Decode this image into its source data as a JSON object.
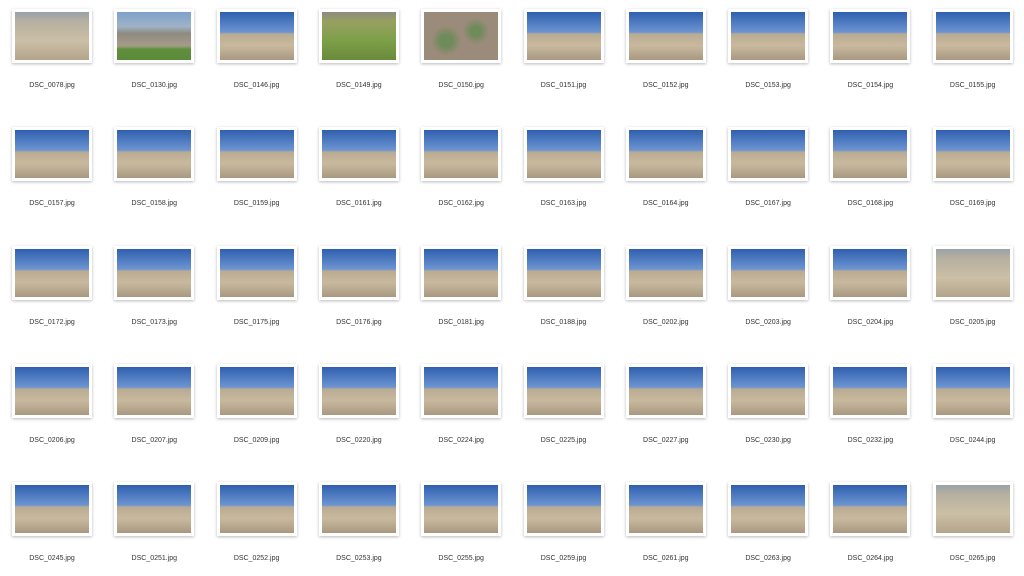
{
  "files": [
    {
      "name": "DSC_0078.jpg",
      "style": "dry"
    },
    {
      "name": "DSC_0130.jpg",
      "style": "mixed"
    },
    {
      "name": "DSC_0146.jpg",
      "style": "sky"
    },
    {
      "name": "DSC_0149.jpg",
      "style": "green"
    },
    {
      "name": "DSC_0150.jpg",
      "style": "plants"
    },
    {
      "name": "DSC_0151.jpg",
      "style": "sky"
    },
    {
      "name": "DSC_0152.jpg",
      "style": "sky"
    },
    {
      "name": "DSC_0153.jpg",
      "style": "sky"
    },
    {
      "name": "DSC_0154.jpg",
      "style": "sky"
    },
    {
      "name": "DSC_0155.jpg",
      "style": "sky"
    },
    {
      "name": "DSC_0157.jpg",
      "style": "sky"
    },
    {
      "name": "DSC_0158.jpg",
      "style": "sky"
    },
    {
      "name": "DSC_0159.jpg",
      "style": "sky"
    },
    {
      "name": "DSC_0161.jpg",
      "style": "sky"
    },
    {
      "name": "DSC_0162.jpg",
      "style": "sky"
    },
    {
      "name": "DSC_0163.jpg",
      "style": "sky"
    },
    {
      "name": "DSC_0164.jpg",
      "style": "sky"
    },
    {
      "name": "DSC_0167.jpg",
      "style": "sky"
    },
    {
      "name": "DSC_0168.jpg",
      "style": "sky"
    },
    {
      "name": "DSC_0169.jpg",
      "style": "sky"
    },
    {
      "name": "DSC_0172.jpg",
      "style": "sky"
    },
    {
      "name": "DSC_0173.jpg",
      "style": "sky"
    },
    {
      "name": "DSC_0175.jpg",
      "style": "sky"
    },
    {
      "name": "DSC_0176.jpg",
      "style": "sky"
    },
    {
      "name": "DSC_0181.jpg",
      "style": "sky"
    },
    {
      "name": "DSC_0188.jpg",
      "style": "sky"
    },
    {
      "name": "DSC_0202.jpg",
      "style": "sky"
    },
    {
      "name": "DSC_0203.jpg",
      "style": "sky"
    },
    {
      "name": "DSC_0204.jpg",
      "style": "sky"
    },
    {
      "name": "DSC_0205.jpg",
      "style": "dry"
    },
    {
      "name": "DSC_0206.jpg",
      "style": "sky"
    },
    {
      "name": "DSC_0207.jpg",
      "style": "sky"
    },
    {
      "name": "DSC_0209.jpg",
      "style": "sky"
    },
    {
      "name": "DSC_0220.jpg",
      "style": "sky"
    },
    {
      "name": "DSC_0224.jpg",
      "style": "sky"
    },
    {
      "name": "DSC_0225.jpg",
      "style": "sky"
    },
    {
      "name": "DSC_0227.jpg",
      "style": "sky"
    },
    {
      "name": "DSC_0230.jpg",
      "style": "sky"
    },
    {
      "name": "DSC_0232.jpg",
      "style": "sky"
    },
    {
      "name": "DSC_0244.jpg",
      "style": "sky"
    },
    {
      "name": "DSC_0245.jpg",
      "style": "sky"
    },
    {
      "name": "DSC_0251.jpg",
      "style": "sky"
    },
    {
      "name": "DSC_0252.jpg",
      "style": "sky"
    },
    {
      "name": "DSC_0253.jpg",
      "style": "sky"
    },
    {
      "name": "DSC_0255.jpg",
      "style": "sky"
    },
    {
      "name": "DSC_0259.jpg",
      "style": "sky"
    },
    {
      "name": "DSC_0261.jpg",
      "style": "sky"
    },
    {
      "name": "DSC_0263.jpg",
      "style": "sky"
    },
    {
      "name": "DSC_0264.jpg",
      "style": "sky"
    },
    {
      "name": "DSC_0265.jpg",
      "style": "dry"
    }
  ]
}
